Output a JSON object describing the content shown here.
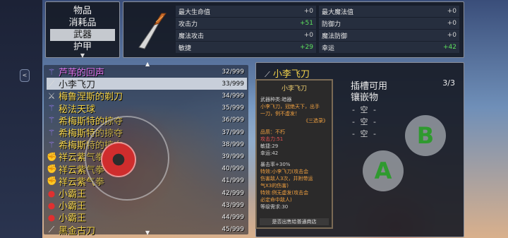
{
  "categories": {
    "items": [
      "物品",
      "消耗品",
      "武器",
      "护甲"
    ],
    "active_index": 2
  },
  "stats": {
    "rows": [
      {
        "label": "最大生命值",
        "value": "+0",
        "up": false
      },
      {
        "label": "最大魔法值",
        "value": "+0",
        "up": false
      },
      {
        "label": "攻击力",
        "value": "+51",
        "up": true
      },
      {
        "label": "防御力",
        "value": "+0",
        "up": false
      },
      {
        "label": "魔法攻击",
        "value": "+0",
        "up": false
      },
      {
        "label": "魔法防御",
        "value": "+0",
        "up": false
      },
      {
        "label": "敏捷",
        "value": "+29",
        "up": true
      },
      {
        "label": "幸运",
        "value": "+42",
        "up": true
      }
    ]
  },
  "items": [
    {
      "name": "芦苇的回声",
      "count": "32/999",
      "icon": "staff-icon",
      "color": "purple"
    },
    {
      "name": "小李飞刀",
      "count": "33/999",
      "icon": "knife-icon",
      "color": "yellow",
      "selected": true
    },
    {
      "name": "梅鲁涅斯的剃刀",
      "count": "34/999",
      "icon": "sword-icon",
      "color": "yellow"
    },
    {
      "name": "秘法天球",
      "count": "35/999",
      "icon": "staff-icon",
      "color": "yellow"
    },
    {
      "name": "希梅斯特的掠夺",
      "count": "36/999",
      "icon": "staff-icon",
      "color": "yellow"
    },
    {
      "name": "希梅斯特的掠夺",
      "count": "37/999",
      "icon": "staff-icon",
      "color": "yellow"
    },
    {
      "name": "希梅斯特的掠夺",
      "count": "38/999",
      "icon": "staff-icon",
      "color": "yellow"
    },
    {
      "name": "祥云紫气拳",
      "count": "39/999",
      "icon": "fist-icon",
      "color": "yellow"
    },
    {
      "name": "祥云紫气拳",
      "count": "40/999",
      "icon": "fist-icon",
      "color": "yellow"
    },
    {
      "name": "祥云紫气拳",
      "count": "41/999",
      "icon": "fist-icon",
      "color": "yellow"
    },
    {
      "name": "小霸王",
      "count": "42/999",
      "icon": "boxing-glove-icon",
      "color": "yellow"
    },
    {
      "name": "小霸王",
      "count": "43/999",
      "icon": "boxing-glove-icon",
      "color": "yellow"
    },
    {
      "name": "小霸王",
      "count": "44/999",
      "icon": "boxing-glove-icon",
      "color": "yellow"
    },
    {
      "name": "黑金古刀",
      "count": "45/999",
      "icon": "knife-icon",
      "color": "yellow"
    }
  ],
  "detail": {
    "title": "小李飞刀",
    "sub1": "插槽可用",
    "sub2": "镶嵌物",
    "slot_count": "3/3",
    "slots": [
      "- 空 -",
      "- 空 -",
      "- 空 -"
    ]
  },
  "tooltip": {
    "title": "小李飞刀",
    "lines": [
      {
        "text": "武器种类:暗器",
        "style": "gray"
      },
      {
        "text": "小李飞刀，冠绝天下，出手",
        "style": "orange"
      },
      {
        "text": "一刀，例不虚发！",
        "style": "orange"
      }
    ],
    "quote": "《三选录》",
    "stats": [
      {
        "text": "品质：不朽",
        "style": "orange"
      },
      {
        "text": "攻击力:51",
        "style": "red"
      },
      {
        "text": "敏捷:29",
        "style": "gray"
      },
      {
        "text": "幸运:42",
        "style": "gray"
      }
    ],
    "effects": [
      {
        "text": "暴击率+30%",
        "style": "gray"
      },
      {
        "text": "特效:小李飞刀(攻击会",
        "style": "orange"
      },
      {
        "text": "伤害敌人3次，并附带运",
        "style": "orange"
      },
      {
        "text": "气X3的伤害)",
        "style": "orange"
      },
      {
        "text": "特效:例无虚发(攻击会",
        "style": "orange"
      },
      {
        "text": "必定命中敌人)",
        "style": "orange"
      },
      {
        "text": "等级需求:30",
        "style": "gray"
      }
    ],
    "footer": "是否出售给普通商店"
  },
  "controls": {
    "a_label": "A",
    "b_label": "B",
    "side_label": "<"
  }
}
